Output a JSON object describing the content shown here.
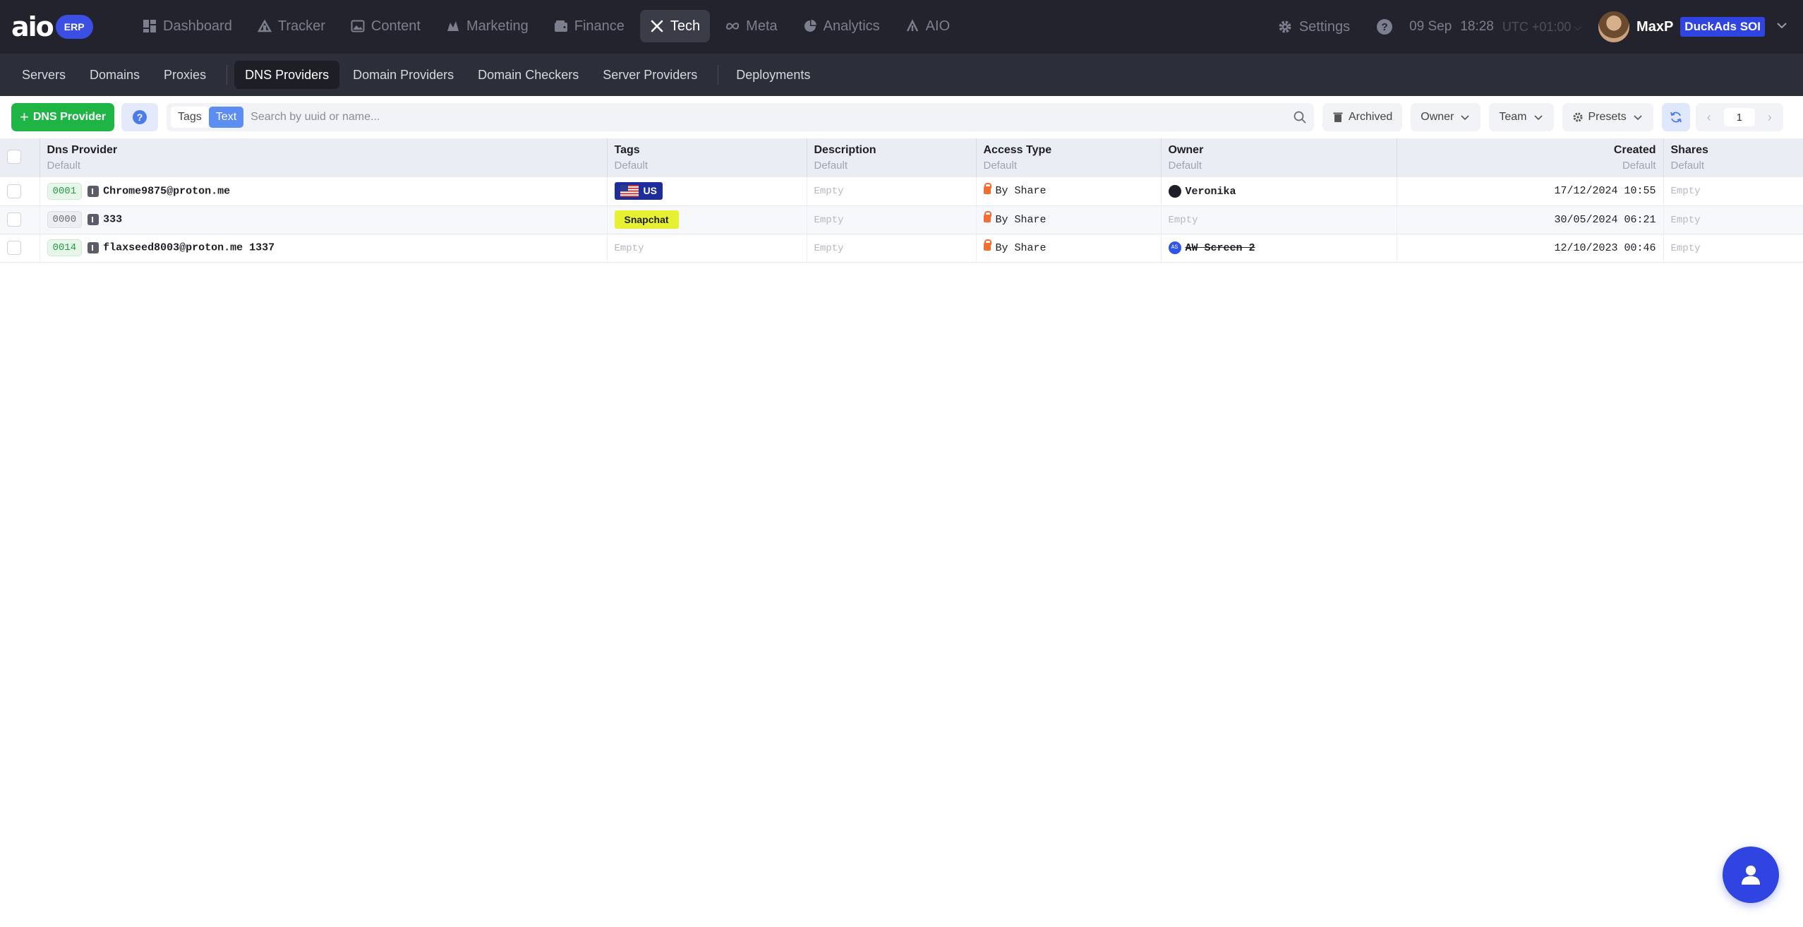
{
  "app": {
    "logo_text": "aio",
    "logo_badge": "ERP"
  },
  "nav": [
    {
      "label": "Dashboard",
      "icon": "dashboard-icon"
    },
    {
      "label": "Tracker",
      "icon": "tracker-icon"
    },
    {
      "label": "Content",
      "icon": "image-icon"
    },
    {
      "label": "Marketing",
      "icon": "marketing-icon"
    },
    {
      "label": "Finance",
      "icon": "wallet-icon"
    },
    {
      "label": "Tech",
      "icon": "tools-icon",
      "active": true
    },
    {
      "label": "Meta",
      "icon": "meta-icon"
    },
    {
      "label": "Analytics",
      "icon": "pie-chart-icon"
    },
    {
      "label": "AIO",
      "icon": "aio-icon"
    }
  ],
  "header": {
    "settings_label": "Settings",
    "help": "?",
    "date": "09 Sep",
    "time": "18:28",
    "timezone": "UTC +01:00",
    "username": "MaxP",
    "company": "DuckAds SOI"
  },
  "subnav": [
    {
      "label": "Servers"
    },
    {
      "label": "Domains"
    },
    {
      "label": "Proxies"
    },
    {
      "label": "DNS Providers",
      "active": true
    },
    {
      "label": "Domain Providers"
    },
    {
      "label": "Domain Checkers"
    },
    {
      "label": "Server Providers"
    },
    {
      "label": "Deployments"
    }
  ],
  "toolbar": {
    "add_label": "DNS Provider",
    "help": "?",
    "mode_tags": "Tags",
    "mode_text": "Text",
    "search_placeholder": "Search by uuid or name...",
    "archived_label": "Archived",
    "owner_label": "Owner",
    "team_label": "Team",
    "presets_label": "Presets",
    "page": "1"
  },
  "table": {
    "columns": [
      {
        "name": "Dns Provider",
        "sub": "Default"
      },
      {
        "name": "Tags",
        "sub": "Default"
      },
      {
        "name": "Description",
        "sub": "Default"
      },
      {
        "name": "Access Type",
        "sub": "Default"
      },
      {
        "name": "Owner",
        "sub": "Default"
      },
      {
        "name": "Created",
        "sub": "Default"
      },
      {
        "name": "Shares",
        "sub": "Default"
      }
    ],
    "rows": [
      {
        "id": "0001",
        "name": "Chrome9875@proton.me",
        "tag": "US",
        "description": "Empty",
        "access": "By Share",
        "owner": "Veronika",
        "created": "17/12/2024 10:55",
        "shares": "Empty"
      },
      {
        "id": "0000",
        "name": "333",
        "tag": "Snapchat",
        "description": "Empty",
        "access": "By Share",
        "owner": "Empty",
        "created": "30/05/2024 06:21",
        "shares": "Empty"
      },
      {
        "id": "0014",
        "name": "flaxseed8003@proton.me 1337",
        "tag": "Empty",
        "description": "Empty",
        "access": "By Share",
        "owner": "AW Screen 2",
        "owner_avatar": "AS",
        "created": "12/10/2023 00:46",
        "shares": "Empty"
      }
    ]
  },
  "colors": {
    "nav_bg": "#22232c",
    "subnav_bg": "#2c2e39",
    "accent": "#2f44e0",
    "add_button": "#1fb545",
    "snapchat_tag": "#e6f231",
    "us_tag": "#1f2c9c"
  }
}
